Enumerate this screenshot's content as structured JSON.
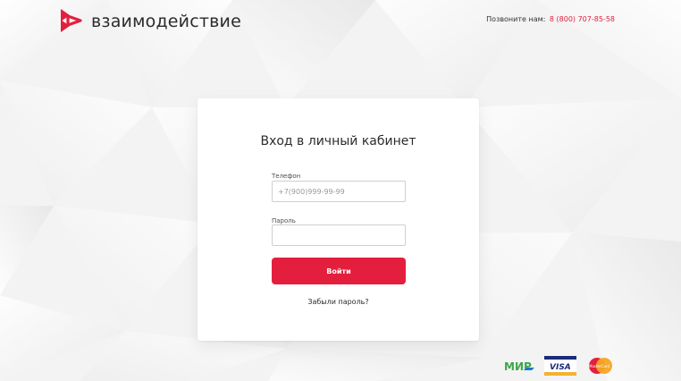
{
  "brand": {
    "name": "взаимодействие",
    "accent": "#e31f3d",
    "text_color": "#2b2b2b"
  },
  "header": {
    "call_label": "Позвоните нам:",
    "phone": "8 (800) 707-85-58"
  },
  "login": {
    "title": "Вход в личный кабинет",
    "phone_label": "Телефон",
    "phone_placeholder": "+7(900)999-99-99",
    "phone_value": "",
    "password_label": "Пароль",
    "password_value": "",
    "submit_label": "Войти",
    "forgot_label": "Забыли пароль?"
  },
  "payment_icons": [
    {
      "name": "mir-icon",
      "text": "МИР"
    },
    {
      "name": "visa-icon",
      "text": "VISA"
    },
    {
      "name": "mastercard-icon",
      "text": "MasterCard"
    }
  ],
  "colors": {
    "background": "#f2f2f2",
    "card": "#ffffff",
    "input_border": "#cfcfcf"
  }
}
